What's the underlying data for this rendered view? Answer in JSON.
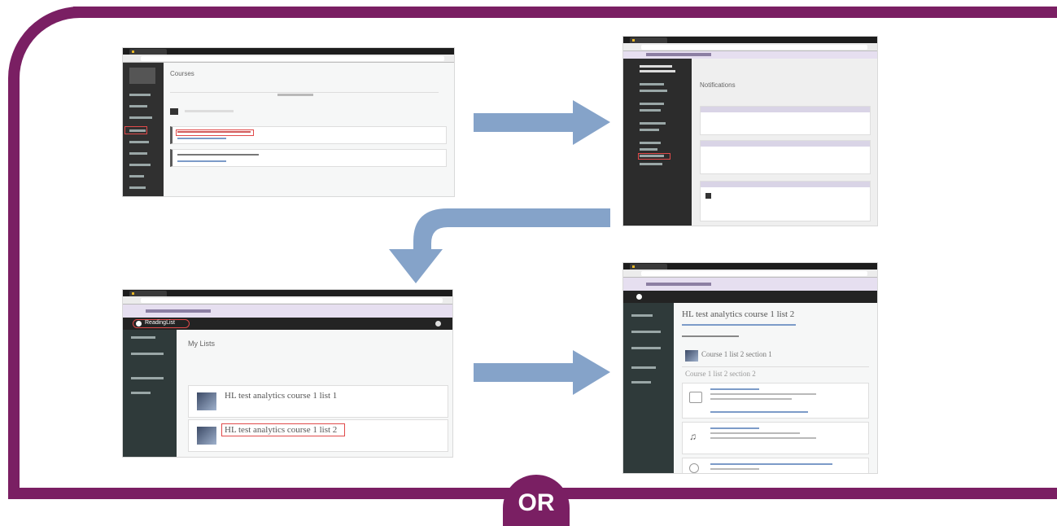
{
  "brand": {
    "frame_color": "#7a1f63",
    "arrow_color": "#85a3c9"
  },
  "separator": {
    "label": "OR"
  },
  "shot1": {
    "heading": "Courses",
    "icons": [
      "dashboard-icon",
      "courses-icon",
      "calendar-icon",
      "inbox-icon",
      "help-icon"
    ]
  },
  "shot2": {
    "heading": "Notifications"
  },
  "shot3": {
    "app_name": "ReadingList",
    "heading": "My Lists",
    "list1_title": "HL test analytics course 1 list 1",
    "list2_title": "HL test analytics course 1 list 2"
  },
  "shot4": {
    "heading": "HL test analytics course 1 list 2",
    "section1": "Course 1 list 2 section 1",
    "section2": "Course 1 list 2 section 2"
  },
  "flow_icons": [
    "arrow-right-icon",
    "arrow-curved-down-left-icon",
    "arrow-right-icon"
  ]
}
